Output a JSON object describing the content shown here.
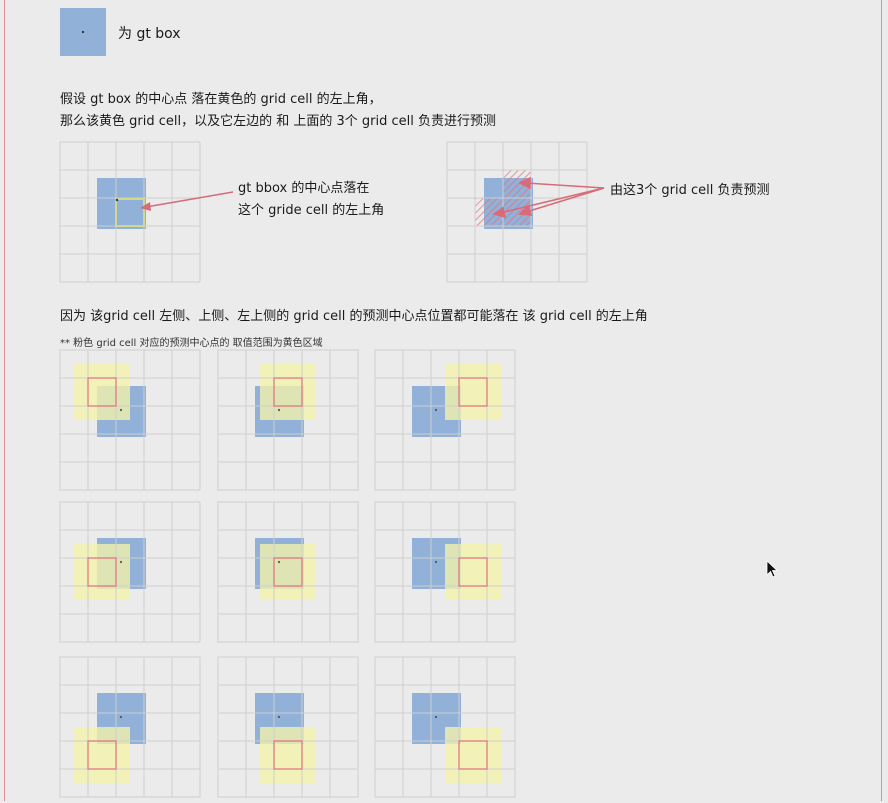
{
  "legend": {
    "label": "为 gt box"
  },
  "intro": {
    "line1": "假设 gt box 的中心点 落在黄色的 grid cell 的左上角，",
    "line2": "那么该黄色 grid cell，以及它左边的 和 上面的 3个 grid cell 负责进行预测"
  },
  "callouts": {
    "left_line1": "gt bbox 的中心点落在",
    "left_line2": "这个 gride cell 的左上角",
    "right": "由这3个 grid cell 负责预测"
  },
  "reason": "因为 该grid cell 左侧、上侧、左上侧的 grid cell 的预测中心点位置都可能落在 该 grid cell 的左上角",
  "note": "** 粉色 grid cell 对应的预测中心点的 取值范围为黄色区域",
  "colors": {
    "gt_box": "#92b1d8",
    "yellow_region": "#f3f2a9",
    "pink_cell": "#e0707e",
    "grid_line": "#cfcfcf",
    "frame": "#e1909a",
    "arrow": "#d96b78"
  }
}
